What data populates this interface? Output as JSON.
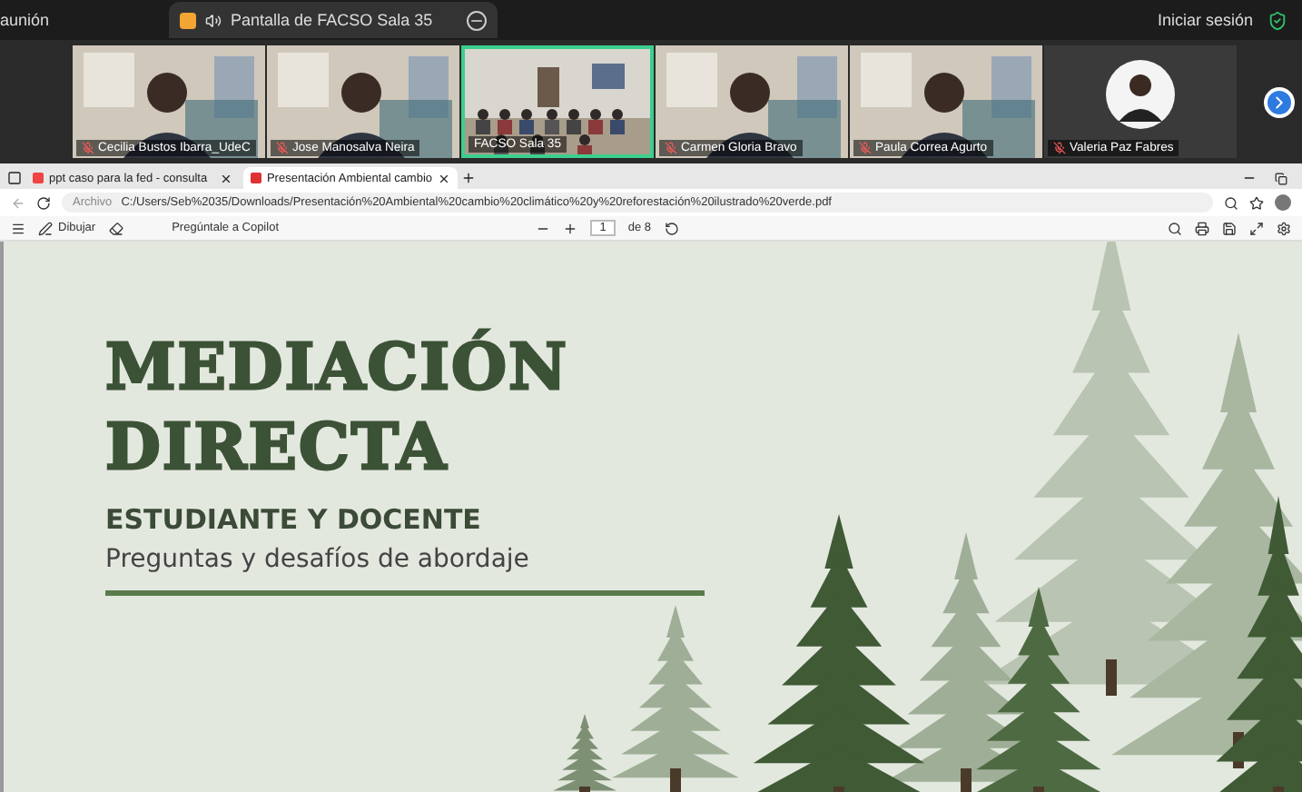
{
  "meeting_bar": {
    "title": "aunión",
    "share_tab": "Pantalla de FACSO Sala 35",
    "sign_in": "Iniciar sesión"
  },
  "participants": [
    {
      "name": "Cecilia Bustos Ibarra_UdeC",
      "kind": "video",
      "muted": true,
      "selected": false
    },
    {
      "name": "Jose Manosalva Neira",
      "kind": "video",
      "muted": true,
      "selected": false
    },
    {
      "name": "FACSO Sala 35",
      "kind": "room",
      "muted": false,
      "selected": true
    },
    {
      "name": "Carmen Gloria Bravo",
      "kind": "video",
      "muted": true,
      "selected": false
    },
    {
      "name": "Paula Correa Agurto",
      "kind": "video",
      "muted": true,
      "selected": false
    },
    {
      "name": "Valeria Paz Fabres",
      "kind": "avatar",
      "muted": true,
      "selected": false
    }
  ],
  "browser": {
    "tabs": [
      {
        "title": "ppt caso para la fed - consulta",
        "selected": false
      },
      {
        "title": "Presentación Ambiental cambio",
        "selected": true
      }
    ],
    "address": {
      "scheme": "Archivo",
      "url": "C:/Users/Seb%2035/Downloads/Presentación%20Ambiental%20cambio%20climático%20y%20reforestación%20ilustrado%20verde.pdf"
    },
    "pdf_toolbar": {
      "draw": "Dibujar",
      "copilot": "Pregúntale a Copilot",
      "page": "1",
      "page_total": "de 8"
    }
  },
  "slide": {
    "title_lines": [
      "MEDIACIÓN",
      "DIRECTA"
    ],
    "subtitle": "ESTUDIANTE Y DOCENTE",
    "tagline": "Preguntas y desafíos de abordaje"
  }
}
